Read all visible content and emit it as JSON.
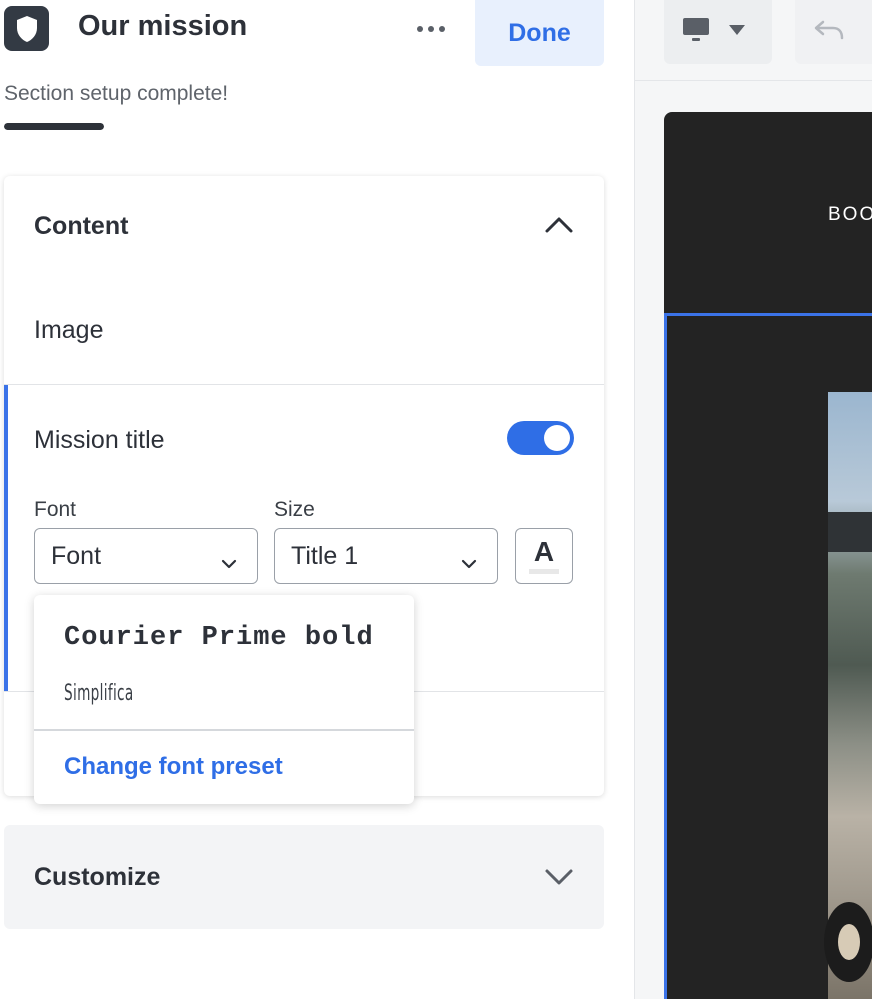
{
  "header": {
    "title": "Our mission",
    "more_icon": "more-horizontal-icon",
    "done_label": "Done",
    "status_text": "Section setup complete!",
    "progress": 1.0
  },
  "content_card": {
    "heading": "Content",
    "image_label": "Image",
    "mission_title": {
      "label": "Mission title",
      "toggle_on": true,
      "font_label": "Font",
      "font_value": "Font",
      "size_label": "Size",
      "size_value": "Title 1",
      "color_button_glyph": "A"
    }
  },
  "font_dropdown": {
    "options": [
      "Courier Prime bold",
      "Simplifica"
    ],
    "action": "Change font preset"
  },
  "customize": {
    "label": "Customize"
  },
  "preview": {
    "device_icon": "desktop-icon",
    "undo_icon": "undo-icon",
    "nav_text": "BOO"
  },
  "colors": {
    "accent": "#2f6ee6",
    "done_bg": "#e8f0fd",
    "preview_bg": "#232323"
  }
}
